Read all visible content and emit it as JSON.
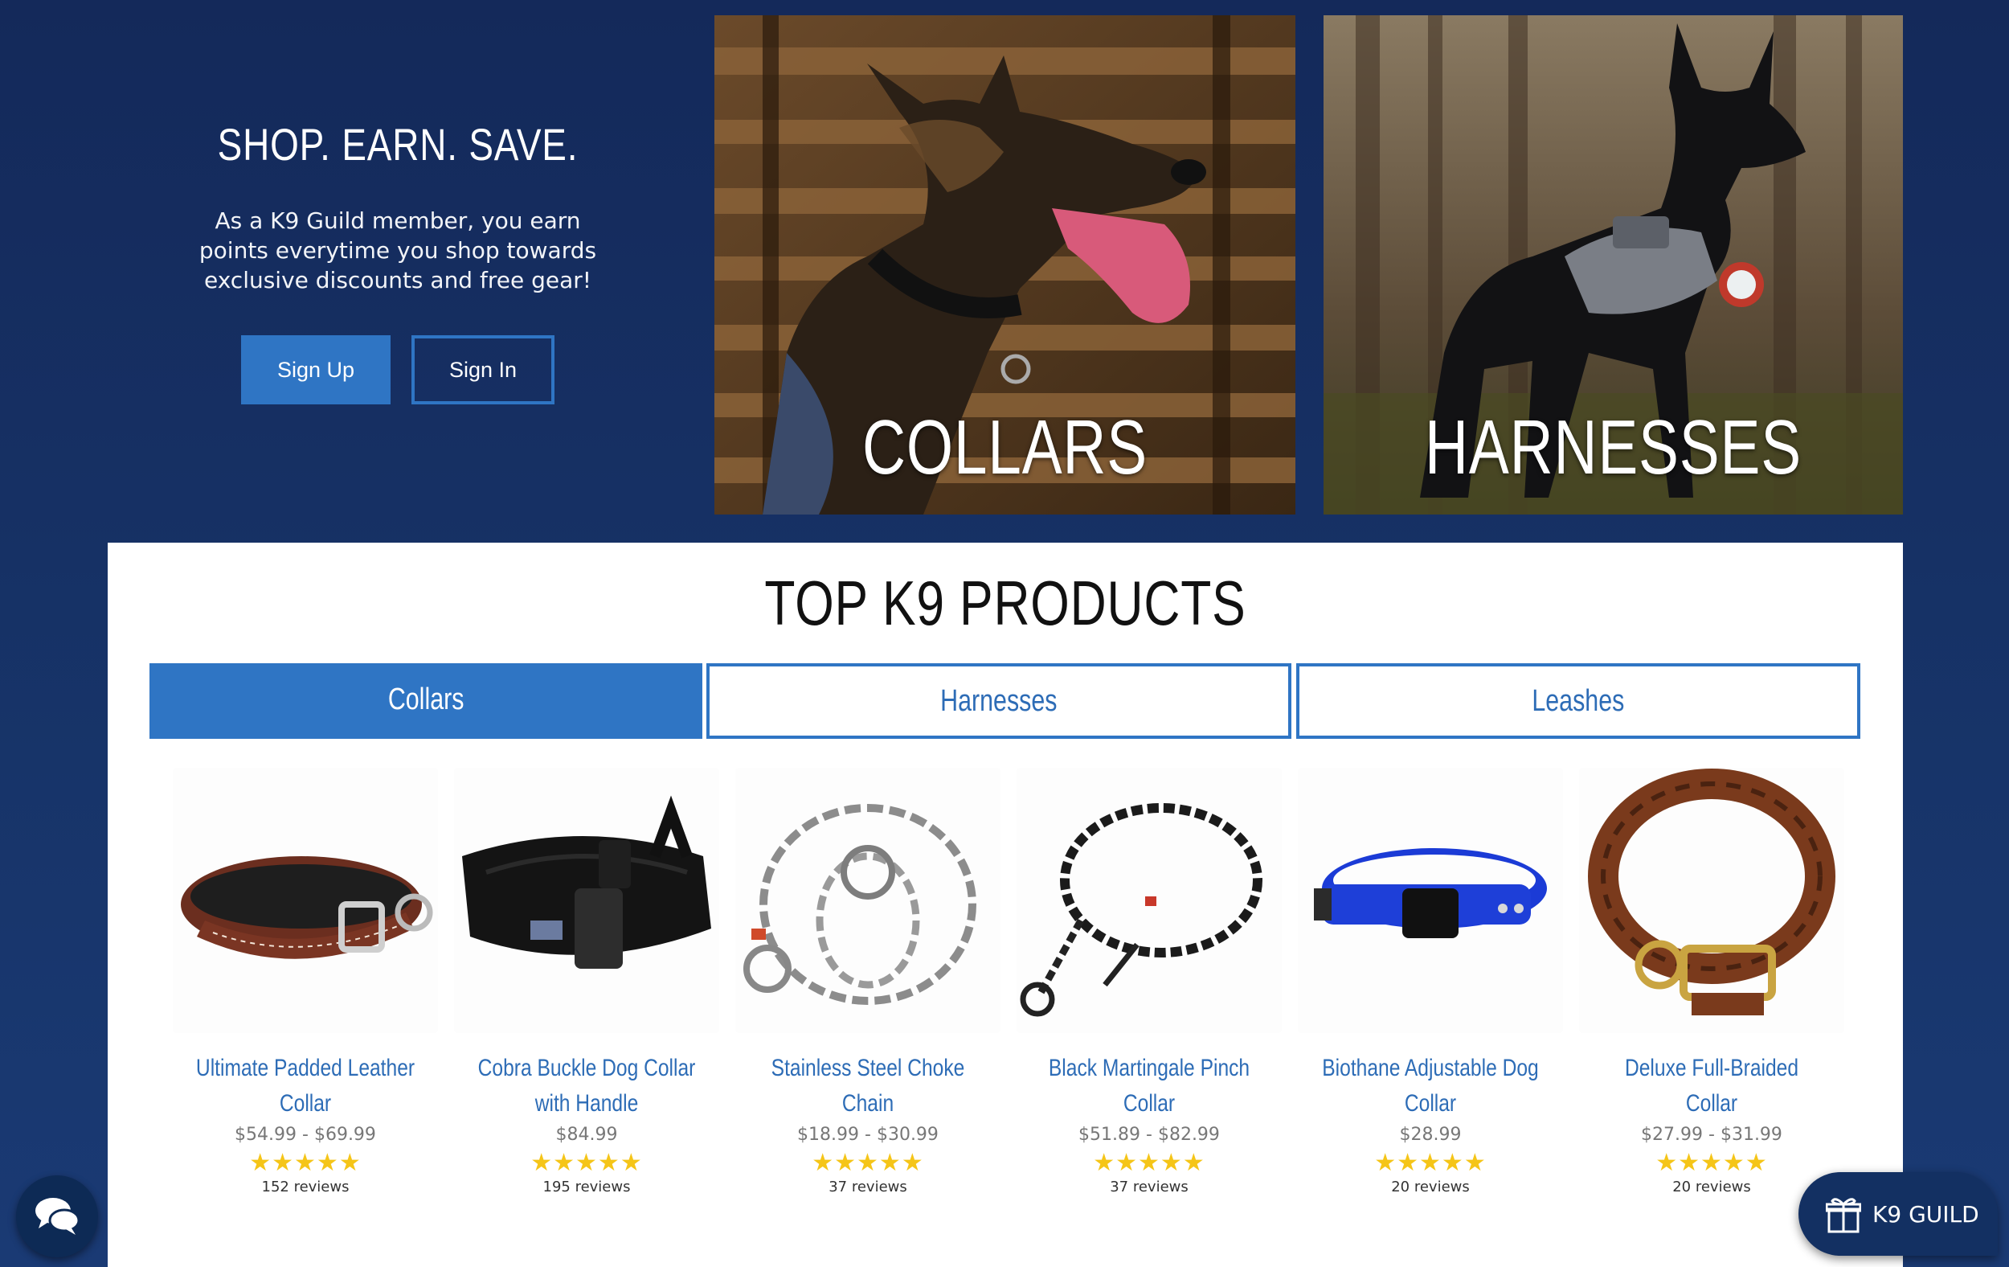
{
  "promo": {
    "title": "SHOP. EARN. SAVE.",
    "text": "As a K9 Guild member, you earn points everytime you shop towards exclusive discounts and free gear!",
    "signup_label": "Sign Up",
    "signin_label": "Sign In"
  },
  "categories": [
    {
      "label": "COLLARS"
    },
    {
      "label": "HARNESSES"
    }
  ],
  "products_section": {
    "title": "TOP K9 PRODUCTS",
    "tabs": [
      {
        "label": "Collars",
        "active": true
      },
      {
        "label": "Harnesses",
        "active": false
      },
      {
        "label": "Leashes",
        "active": false
      }
    ],
    "products": [
      {
        "name": "Ultimate Padded Leather Collar",
        "price": "$54.99 - $69.99",
        "rating": 5,
        "reviews": "152 reviews"
      },
      {
        "name": "Cobra Buckle Dog Collar with Handle",
        "price": "$84.99",
        "rating": 5,
        "reviews": "195 reviews"
      },
      {
        "name": "Stainless Steel Choke Chain",
        "price": "$18.99 - $30.99",
        "rating": 5,
        "reviews": "37 reviews"
      },
      {
        "name": "Black Martingale Pinch Collar",
        "price": "$51.89 - $82.99",
        "rating": 5,
        "reviews": "37 reviews"
      },
      {
        "name": "Biothane Adjustable Dog Collar",
        "price": "$28.99",
        "rating": 5,
        "reviews": "20 reviews"
      },
      {
        "name": "Deluxe Full-Braided Collar",
        "price": "$27.99 - $31.99",
        "rating": 5,
        "reviews": "20 reviews"
      }
    ]
  },
  "guild_widget": {
    "label": "K9 GUILD"
  },
  "icons": {
    "chat": "chat-bubbles-icon",
    "gift": "gift-icon"
  },
  "colors": {
    "background": "#16305f",
    "accent": "#2f75c4",
    "link": "#2d6cb6",
    "star": "#f5c518"
  }
}
